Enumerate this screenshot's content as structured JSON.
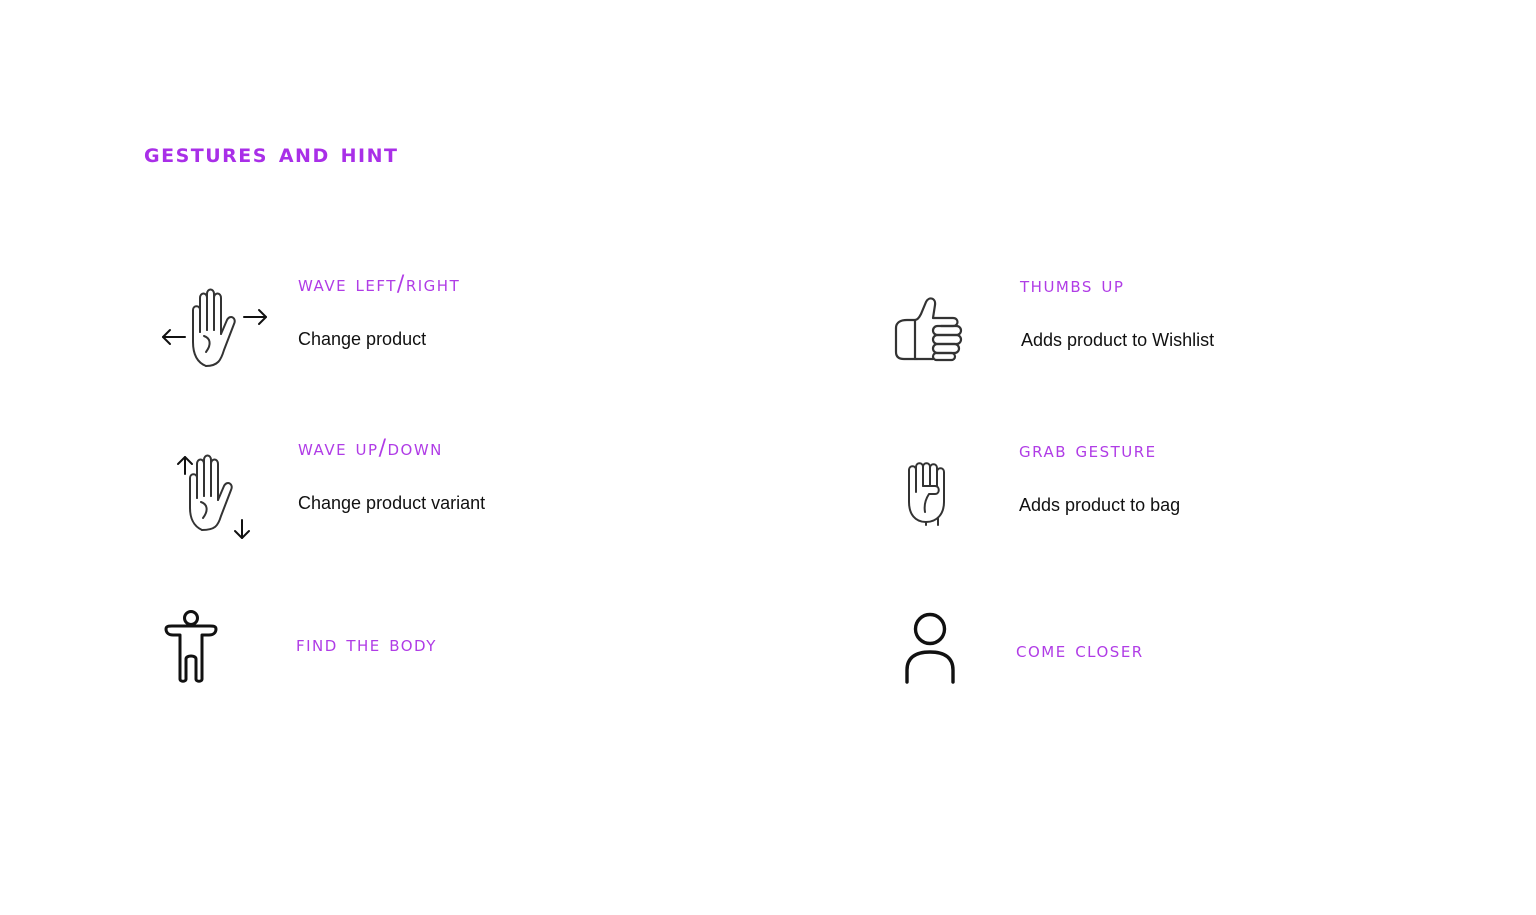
{
  "page": {
    "title": "Gestures and hint",
    "accent_color": "#a92fe8",
    "text_color": "#111111"
  },
  "gestures": [
    {
      "icon": "hand-wave-left-right-icon",
      "title": "Wave left/right",
      "description": "Change product"
    },
    {
      "icon": "thumbs-up-icon",
      "title": "Thumbs up",
      "description": "Adds product to Wishlist"
    },
    {
      "icon": "hand-wave-up-down-icon",
      "title": "Wave up/down",
      "description": "Change product variant"
    },
    {
      "icon": "grab-fist-icon",
      "title": "Grab gesture",
      "description": "Adds product to bag"
    },
    {
      "icon": "body-figure-icon",
      "title": "Find the body",
      "description": ""
    },
    {
      "icon": "user-person-icon",
      "title": "Come closer",
      "description": ""
    }
  ]
}
